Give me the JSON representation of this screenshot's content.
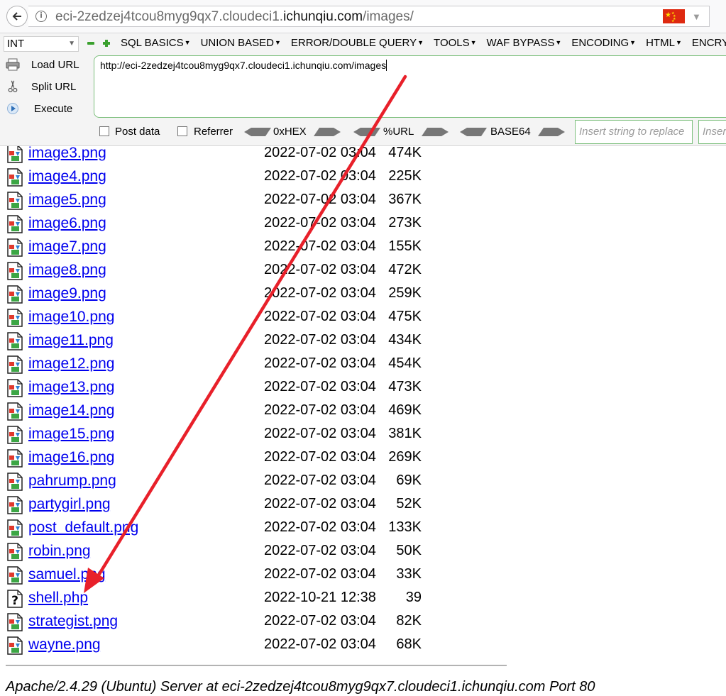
{
  "address_bar": {
    "url_prefix": "eci-2zedzej4tcou8myg9qx7.cloudeci1.",
    "url_host": "ichunqiu.com",
    "url_suffix": "/images/"
  },
  "hackbar": {
    "db_type": "INT",
    "menus": [
      "SQL BASICS",
      "UNION BASED",
      "ERROR/DOUBLE QUERY",
      "TOOLS",
      "WAF BYPASS",
      "ENCODING",
      "HTML",
      "ENCRYPTION"
    ],
    "buttons": {
      "load_url": "Load URL",
      "split_url": "Split URL",
      "execute": "Execute"
    },
    "url_value": "http://eci-2zedzej4tcou8myg9qx7.cloudeci1.ichunqiu.com/images",
    "options": {
      "post_data": "Post data",
      "referrer": "Referrer",
      "hex": "0xHEX",
      "url_enc": "%URL",
      "base64": "BASE64",
      "replace_placeholder": "Insert string to replace",
      "replace_with_placeholder": "Insert replacing string"
    }
  },
  "files": [
    {
      "name": "image3.png",
      "date": "2022-07-02 03:04",
      "size": "474K",
      "type": "image"
    },
    {
      "name": "image4.png",
      "date": "2022-07-02 03:04",
      "size": "225K",
      "type": "image"
    },
    {
      "name": "image5.png",
      "date": "2022-07-02 03:04",
      "size": "367K",
      "type": "image"
    },
    {
      "name": "image6.png",
      "date": "2022-07-02 03:04",
      "size": "273K",
      "type": "image"
    },
    {
      "name": "image7.png",
      "date": "2022-07-02 03:04",
      "size": "155K",
      "type": "image"
    },
    {
      "name": "image8.png",
      "date": "2022-07-02 03:04",
      "size": "472K",
      "type": "image"
    },
    {
      "name": "image9.png",
      "date": "2022-07-02 03:04",
      "size": "259K",
      "type": "image"
    },
    {
      "name": "image10.png",
      "date": "2022-07-02 03:04",
      "size": "475K",
      "type": "image"
    },
    {
      "name": "image11.png",
      "date": "2022-07-02 03:04",
      "size": "434K",
      "type": "image"
    },
    {
      "name": "image12.png",
      "date": "2022-07-02 03:04",
      "size": "454K",
      "type": "image"
    },
    {
      "name": "image13.png",
      "date": "2022-07-02 03:04",
      "size": "473K",
      "type": "image"
    },
    {
      "name": "image14.png",
      "date": "2022-07-02 03:04",
      "size": "469K",
      "type": "image"
    },
    {
      "name": "image15.png",
      "date": "2022-07-02 03:04",
      "size": "381K",
      "type": "image"
    },
    {
      "name": "image16.png",
      "date": "2022-07-02 03:04",
      "size": "269K",
      "type": "image"
    },
    {
      "name": "pahrump.png",
      "date": "2022-07-02 03:04",
      "size": "69K",
      "type": "image"
    },
    {
      "name": "partygirl.png",
      "date": "2022-07-02 03:04",
      "size": "52K",
      "type": "image"
    },
    {
      "name": "post_default.png",
      "date": "2022-07-02 03:04",
      "size": "133K",
      "type": "image"
    },
    {
      "name": "robin.png",
      "date": "2022-07-02 03:04",
      "size": "50K",
      "type": "image"
    },
    {
      "name": "samuel.png",
      "date": "2022-07-02 03:04",
      "size": "33K",
      "type": "image"
    },
    {
      "name": "shell.php",
      "date": "2022-10-21 12:38",
      "size": "39",
      "type": "unknown"
    },
    {
      "name": "strategist.png",
      "date": "2022-07-02 03:04",
      "size": "82K",
      "type": "image"
    },
    {
      "name": "wayne.png",
      "date": "2022-07-02 03:04",
      "size": "68K",
      "type": "image"
    }
  ],
  "footer": "Apache/2.4.29 (Ubuntu) Server at eci-2zedzej4tcou8myg9qx7.cloudeci1.ichunqiu.com Port 80",
  "colors": {
    "annotation_arrow": "#e8202a",
    "link": "#0000ee",
    "hackbar_border": "#7cbf7c"
  }
}
